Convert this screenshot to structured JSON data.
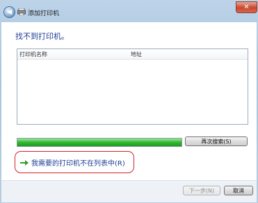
{
  "window": {
    "title": "添加打印机",
    "back_symbol": "◀",
    "close_symbol": "✕"
  },
  "heading": "找不到打印机。",
  "list": {
    "columns": [
      "打印机名称",
      "地址"
    ]
  },
  "progress": {
    "fill_percent": 100,
    "color": "#30b82f"
  },
  "buttons": {
    "search_again": "再次搜索(S)",
    "next": "下一步(N)",
    "cancel": "取消"
  },
  "link": {
    "label": "我需要的打印机不在列表中(R)",
    "color": "#1f3d94"
  },
  "highlight_color": "#d1222a",
  "icons": [
    "back-arrow-icon",
    "printer-icon",
    "close-icon",
    "green-arrow-icon"
  ]
}
